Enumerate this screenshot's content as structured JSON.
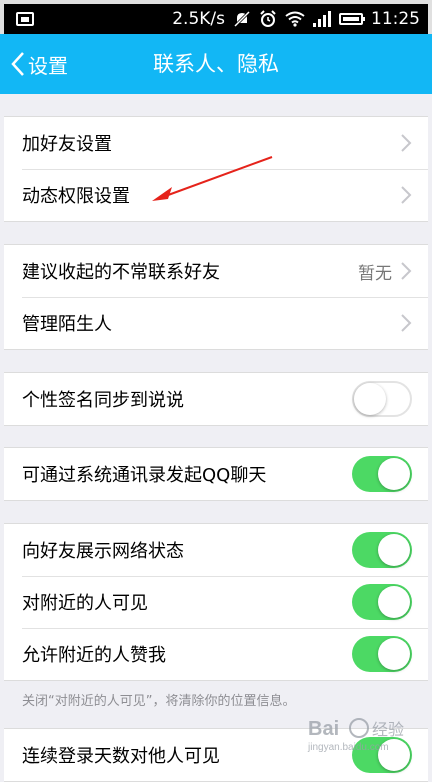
{
  "status_bar": {
    "speed": "2.5K/s",
    "time": "11:25"
  },
  "nav": {
    "back_label": "设置",
    "title": "联系人、隐私"
  },
  "groups": {
    "friends": {
      "add_friend": "加好友设置",
      "feed_permission": "动态权限设置"
    },
    "suggest": {
      "fold_contacts": "建议收起的不常联系好友",
      "fold_contacts_value": "暂无",
      "strangers": "管理陌生人"
    },
    "signature": {
      "sync_label": "个性签名同步到说说",
      "sync_state": false
    },
    "contacts": {
      "qq_chat_label": "可通过系统通讯录发起QQ聊天",
      "qq_chat_state": true
    },
    "visibility": {
      "network_status_label": "向好友展示网络状态",
      "network_status_state": true,
      "nearby_visible_label": "对附近的人可见",
      "nearby_visible_state": true,
      "nearby_like_label": "允许附近的人赞我",
      "nearby_like_state": true
    },
    "footnote": "关闭“对附近的人可见”，将清除你的位置信息。",
    "login_days": {
      "label": "连续登录天数对他人可见",
      "state": true
    }
  },
  "watermark": {
    "brand": "Bai",
    "brand_cn": "经验",
    "url": "jingyan.baidu.com"
  },
  "colors": {
    "nav": "#12b7f5",
    "toggle_on": "#4cd964",
    "annotation": "#e5231b"
  }
}
